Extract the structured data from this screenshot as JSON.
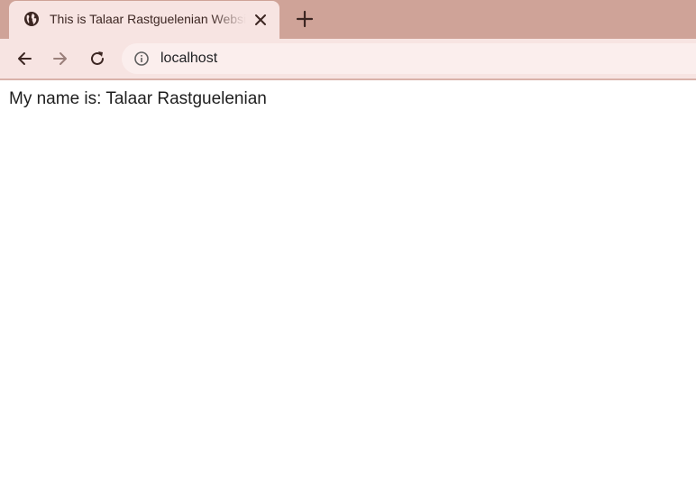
{
  "browser": {
    "tab": {
      "title": "This is Talaar Rastguelenian Website"
    },
    "address_bar": {
      "url": "localhost"
    }
  },
  "page": {
    "body_text": "My name is: Talaar Rastguelenian"
  },
  "icons": {
    "favicon": "globe-icon",
    "close": "close-icon",
    "new_tab": "plus-icon",
    "back": "back-arrow-icon",
    "forward": "forward-arrow-icon",
    "reload": "reload-icon",
    "site_info": "info-icon"
  },
  "colors": {
    "tabstrip_bg": "#cfa398",
    "active_tab_bg": "#f7e4e2",
    "omnibox_bg": "#fbeeed"
  }
}
